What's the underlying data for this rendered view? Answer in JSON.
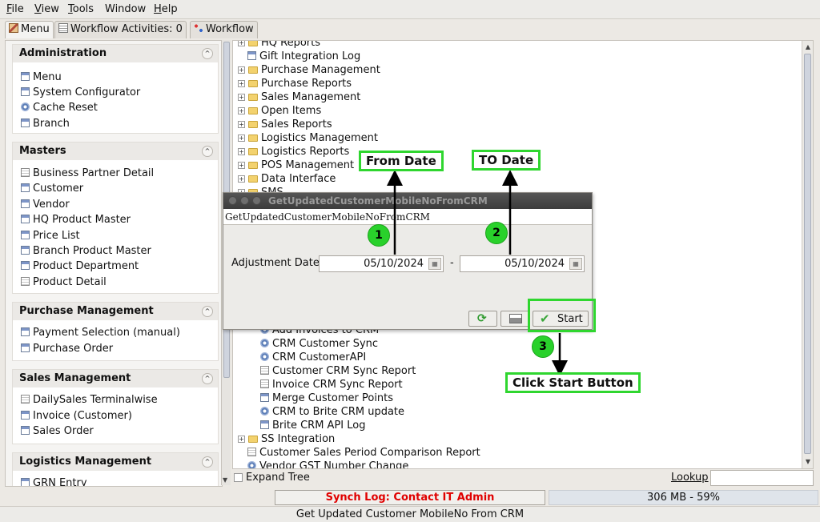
{
  "menubar": [
    {
      "label": "File",
      "mnemonic": "F",
      "rest": "ile"
    },
    {
      "label": "View",
      "mnemonic": "V",
      "rest": "iew"
    },
    {
      "label": "Tools",
      "mnemonic": "T",
      "rest": "ools"
    },
    {
      "label": "Window",
      "mnemonic": "",
      "rest": "Window"
    },
    {
      "label": "Help",
      "mnemonic": "H",
      "rest": "elp"
    }
  ],
  "tabs": [
    {
      "label": "Menu",
      "icon": "home-icon"
    },
    {
      "label": "Workflow Activities: 0",
      "icon": "list-icon"
    },
    {
      "label": "Workflow",
      "icon": "workflow-icon"
    }
  ],
  "sections": [
    {
      "title": "Administration",
      "items": [
        {
          "label": "Menu",
          "icon": "window"
        },
        {
          "label": "System Configurator",
          "icon": "window"
        },
        {
          "label": "Cache Reset",
          "icon": "gear"
        },
        {
          "label": "Branch",
          "icon": "window"
        }
      ]
    },
    {
      "title": "Masters",
      "items": [
        {
          "label": "Business Partner Detail",
          "icon": "doc"
        },
        {
          "label": "Customer",
          "icon": "window"
        },
        {
          "label": "Vendor",
          "icon": "window"
        },
        {
          "label": "HQ Product Master",
          "icon": "window"
        },
        {
          "label": "Price List",
          "icon": "window"
        },
        {
          "label": "Branch Product Master",
          "icon": "window"
        },
        {
          "label": "Product Department",
          "icon": "window"
        },
        {
          "label": "Product Detail",
          "icon": "doc"
        }
      ]
    },
    {
      "title": "Purchase Management",
      "items": [
        {
          "label": "Payment Selection (manual)",
          "icon": "window"
        },
        {
          "label": "Purchase Order",
          "icon": "window"
        }
      ]
    },
    {
      "title": "Sales Management",
      "items": [
        {
          "label": "DailySales Terminalwise",
          "icon": "doc"
        },
        {
          "label": "Invoice (Customer)",
          "icon": "window"
        },
        {
          "label": "Sales Order",
          "icon": "window"
        }
      ]
    },
    {
      "title": "Logistics Management",
      "items": [
        {
          "label": "GRN Entry",
          "icon": "window"
        }
      ]
    }
  ],
  "tree": {
    "top": [
      {
        "label": "HQ Reports",
        "type": "folder"
      },
      {
        "label": "Gift Integration Log",
        "type": "window"
      },
      {
        "label": "Purchase Management",
        "type": "folder"
      },
      {
        "label": "Purchase Reports",
        "type": "folder"
      },
      {
        "label": "Sales Management",
        "type": "folder"
      },
      {
        "label": "Open Items",
        "type": "folder"
      },
      {
        "label": "Sales Reports",
        "type": "folder"
      },
      {
        "label": "Logistics Management",
        "type": "folder"
      },
      {
        "label": "Logistics Reports",
        "type": "folder"
      },
      {
        "label": "POS Management",
        "type": "folder"
      },
      {
        "label": "Data Interface",
        "type": "folder"
      },
      {
        "label": "SMS",
        "type": "folder"
      }
    ],
    "crm": [
      {
        "label": "Add Invoices to CRM",
        "type": "gear"
      },
      {
        "label": "CRM Customer Sync",
        "type": "gear"
      },
      {
        "label": "CRM CustomerAPI",
        "type": "gear"
      },
      {
        "label": "Customer CRM Sync Report",
        "type": "doc"
      },
      {
        "label": "Invoice CRM Sync Report",
        "type": "doc"
      },
      {
        "label": "Merge Customer Points",
        "type": "window"
      },
      {
        "label": "CRM to Brite CRM update",
        "type": "gear"
      },
      {
        "label": "Brite CRM API Log",
        "type": "window"
      }
    ],
    "bottom": [
      {
        "label": "SS Integration",
        "type": "folder"
      },
      {
        "label": "Customer Sales Period Comparison Report",
        "type": "doc"
      },
      {
        "label": "Vendor GST Number Change",
        "type": "gear"
      }
    ]
  },
  "expand_tree_label": "Expand Tree",
  "lookup_label": "Lookup",
  "lookup_value": "",
  "status": {
    "synch_log": "Synch Log: Contact IT Admin",
    "memory": "306 MB - 59%"
  },
  "footer_text": "Get Updated Customer MobileNo From CRM",
  "dialog": {
    "title": "GetUpdatedCustomerMobileNoFromCRM",
    "header": "GetUpdatedCustomerMobileNoFromCRM",
    "adjustment_date_label": "Adjustment Date",
    "from_date": "05/10/2024",
    "range_separator": "-",
    "to_date": "05/10/2024",
    "start_label": "Start"
  },
  "annotations": {
    "from_date": "From Date",
    "to_date": "TO Date",
    "click_start": "Click Start Button",
    "step1": "1",
    "step2": "2",
    "step3": "3"
  },
  "colors": {
    "annotation_green": "#2fd62f",
    "status_red": "#e00000"
  }
}
